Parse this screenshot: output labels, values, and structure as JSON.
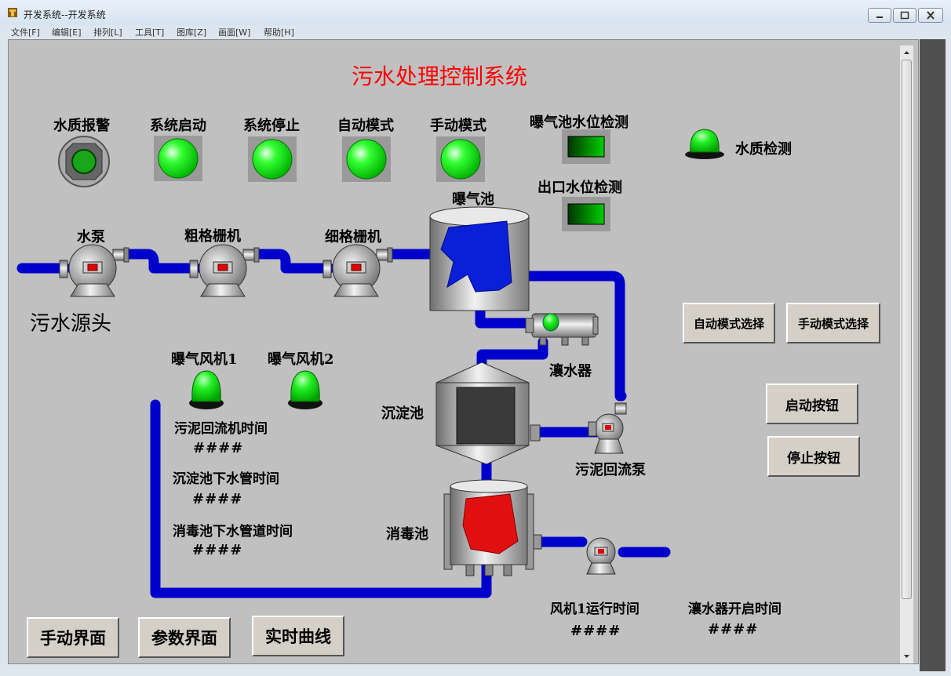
{
  "window": {
    "title": "开发系统--开发系统"
  },
  "menu": [
    "文件[F]",
    "编辑[E]",
    "排列[L]",
    "工具[T]",
    "图库[Z]",
    "画面[W]",
    "帮助[H]"
  ],
  "screen": {
    "title": "污水处理控制系统",
    "title_color": "#ff0000",
    "source_label": "污水源头",
    "indicators": {
      "water_quality_alarm": "水质报警",
      "system_start": "系统启动",
      "system_stop": "系统停止",
      "auto_mode": "自动模式",
      "manual_mode": "手动模式",
      "aeration_level_detect": "曝气池水位检测",
      "outlet_level_detect": "出口水位检测",
      "water_quality_detect": "水质检测"
    },
    "equipment": {
      "pump": "水泵",
      "coarse_screen": "粗格栅机",
      "fine_screen": "细格栅机",
      "aeration_tank": "曝气池",
      "aerator": "瀼水器",
      "sedimentation_tank": "沉淀池",
      "sludge_return_pump": "污泥回流泵",
      "disinfection_tank": "消毒池",
      "fan1": "曝气风机1",
      "fan2": "曝气风机2"
    },
    "timers": {
      "sludge_return_label": "污泥回流机时间",
      "sludge_return_value": "####",
      "sed_drain_label": "沉淀池下水管时间",
      "sed_drain_value": "####",
      "dis_drain_label": "消毒池下水管道时间",
      "dis_drain_value": "####",
      "fan1_runtime_label": "风机1运行时间",
      "fan1_runtime_value": "####",
      "aerator_open_label": "瀼水器开启时间",
      "aerator_open_value": "####"
    },
    "buttons": {
      "auto_select": "自动模式选择",
      "manual_select": "手动模式选择",
      "start": "启动按钮",
      "stop": "停止按钮",
      "manual_screen": "手动界面",
      "param_screen": "参数界面",
      "realtime_curve": "实时曲线"
    },
    "colors": {
      "background": "#c0c0c0",
      "pipe": "#0000cc",
      "lamp_on": "#00ee00",
      "aeration_fluid": "#0a1fd8",
      "disinfection_fluid": "#e01010"
    }
  }
}
